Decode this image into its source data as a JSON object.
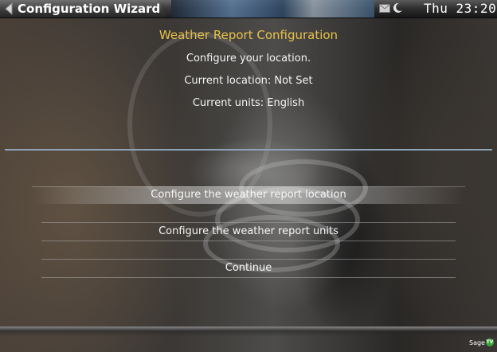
{
  "header": {
    "title": "Configuration Wizard",
    "clock": "Thu 23:20",
    "icons": {
      "back": "back-arrow-icon",
      "mail": "mail-icon",
      "status": "moon-icon"
    }
  },
  "main": {
    "page_title": "Weather Report Configuration",
    "instruction": "Configure your location.",
    "current_location": "Current location: Not Set",
    "current_units": "Current units: English"
  },
  "menu": {
    "items": [
      {
        "label": "Configure the weather report location",
        "focused": true
      },
      {
        "label": "Configure the weather report units",
        "focused": false
      },
      {
        "label": "Continue",
        "focused": false
      }
    ]
  },
  "footer": {
    "logo_text": "Sage",
    "logo_badge": "TV"
  },
  "colors": {
    "title_accent": "#e8c048",
    "divider": "#8ea4b8",
    "logo_badge": "#3aa63a"
  }
}
